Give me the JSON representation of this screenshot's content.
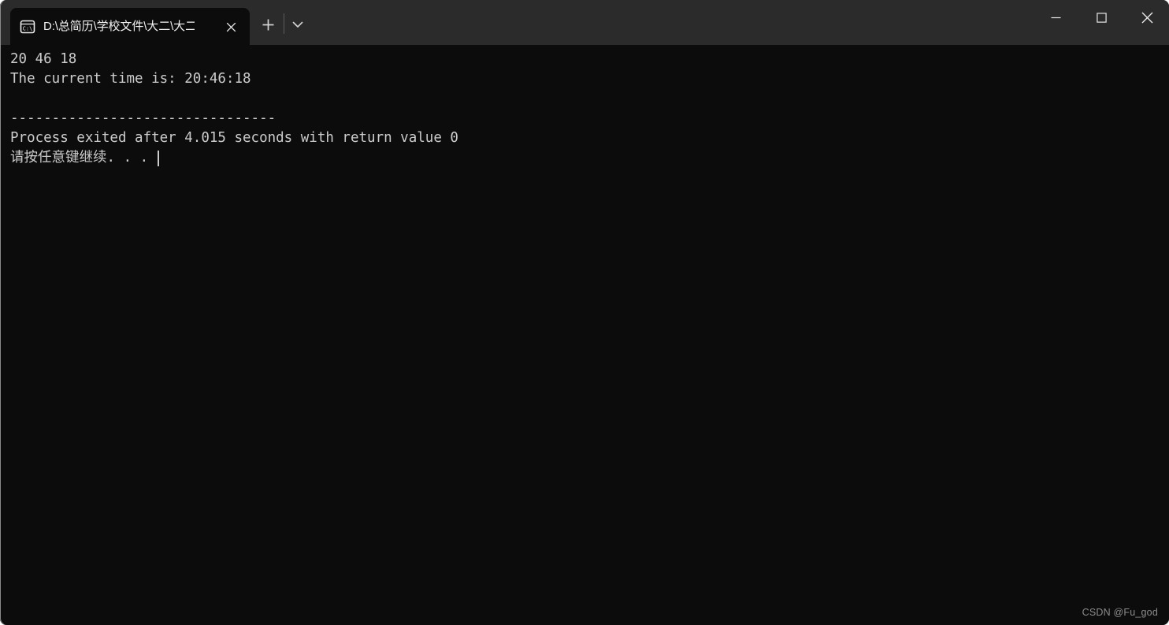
{
  "window": {
    "title_bar": {
      "tab": {
        "icon": "command-prompt-icon",
        "label": "D:\\总简历\\学校文件\\大二\\大二",
        "close_label": "✕"
      },
      "new_tab_label": "+",
      "dropdown_label": "⌄",
      "controls": {
        "minimize_label": "—",
        "maximize_label": "▢",
        "close_label": "✕"
      }
    },
    "colors": {
      "title_bar_bg": "#2b2b2b",
      "terminal_bg": "#0c0c0c",
      "terminal_fg": "#cccccc",
      "tab_active_bg": "#0c0c0c",
      "watermark_fg": "#8c8c8c"
    }
  },
  "terminal": {
    "lines": [
      "20 46 18",
      "The current time is: 20:46:18",
      "",
      "--------------------------------",
      "Process exited after 4.015 seconds with return value 0"
    ],
    "prompt_line": "请按任意键继续. . .",
    "cursor": "|"
  },
  "watermark": {
    "text": "CSDN @Fu_god"
  }
}
